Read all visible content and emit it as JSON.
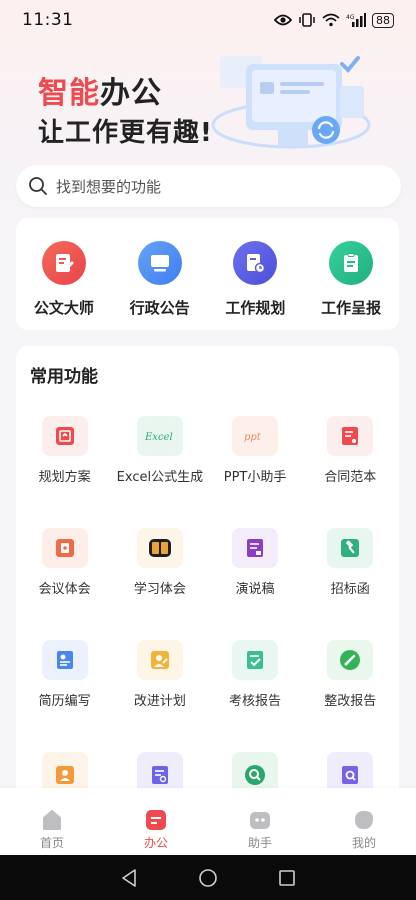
{
  "status_bar": {
    "time": "11:31",
    "battery": "88"
  },
  "hero": {
    "title_accent": "智能",
    "title_rest": "办公",
    "subtitle": "让工作更有趣!"
  },
  "search": {
    "placeholder": "找到想要的功能"
  },
  "quick_actions": [
    {
      "label": "公文大师",
      "icon": "document-edit-icon",
      "color": "#ef5a4c"
    },
    {
      "label": "行政公告",
      "icon": "monitor-icon",
      "color": "#4f8cf4"
    },
    {
      "label": "工作规划",
      "icon": "calendar-plan-icon",
      "color": "#5a5fe0"
    },
    {
      "label": "工作呈报",
      "icon": "clipboard-icon",
      "color": "#27bd8f"
    }
  ],
  "features": {
    "title": "常用功能",
    "items": [
      {
        "label": "规划方案",
        "icon": "plan-icon",
        "color": "#ef4b4f"
      },
      {
        "label": "Excel公式生成",
        "icon": "excel-icon",
        "color": "#2aa77a"
      },
      {
        "label": "PPT小助手",
        "icon": "ppt-icon",
        "color": "#f08a5d"
      },
      {
        "label": "合同范本",
        "icon": "contract-icon",
        "color": "#ee4a4f"
      },
      {
        "label": "会议体会",
        "icon": "meeting-icon",
        "color": "#f06a4a"
      },
      {
        "label": "学习体会",
        "icon": "book-icon",
        "color": "#e8a33a"
      },
      {
        "label": "演说稿",
        "icon": "speech-icon",
        "color": "#8b3fc3"
      },
      {
        "label": "招标函",
        "icon": "gavel-icon",
        "color": "#2fb07f"
      },
      {
        "label": "简历编写",
        "icon": "resume-icon",
        "color": "#4a86f0"
      },
      {
        "label": "改进计划",
        "icon": "improve-icon",
        "color": "#f2b33a"
      },
      {
        "label": "考核报告",
        "icon": "review-icon",
        "color": "#3dbd93"
      },
      {
        "label": "整改报告",
        "icon": "rectify-icon",
        "color": "#34b25a"
      },
      {
        "label": "",
        "icon": "person-card-icon",
        "color": "#f29a3a"
      },
      {
        "label": "",
        "icon": "form-icon",
        "color": "#6c63e6"
      },
      {
        "label": "",
        "icon": "search-doc-icon",
        "color": "#2aa86a"
      },
      {
        "label": "",
        "icon": "doc-search-icon",
        "color": "#7a62e8"
      }
    ]
  },
  "bottom_nav": [
    {
      "label": "首页",
      "icon": "home-icon",
      "active": false
    },
    {
      "label": "办公",
      "icon": "office-icon",
      "active": true
    },
    {
      "label": "助手",
      "icon": "assistant-icon",
      "active": false
    },
    {
      "label": "我的",
      "icon": "profile-icon",
      "active": false
    }
  ],
  "colors": {
    "accent": "#ee4a4f",
    "background": "#f5f5f7"
  }
}
